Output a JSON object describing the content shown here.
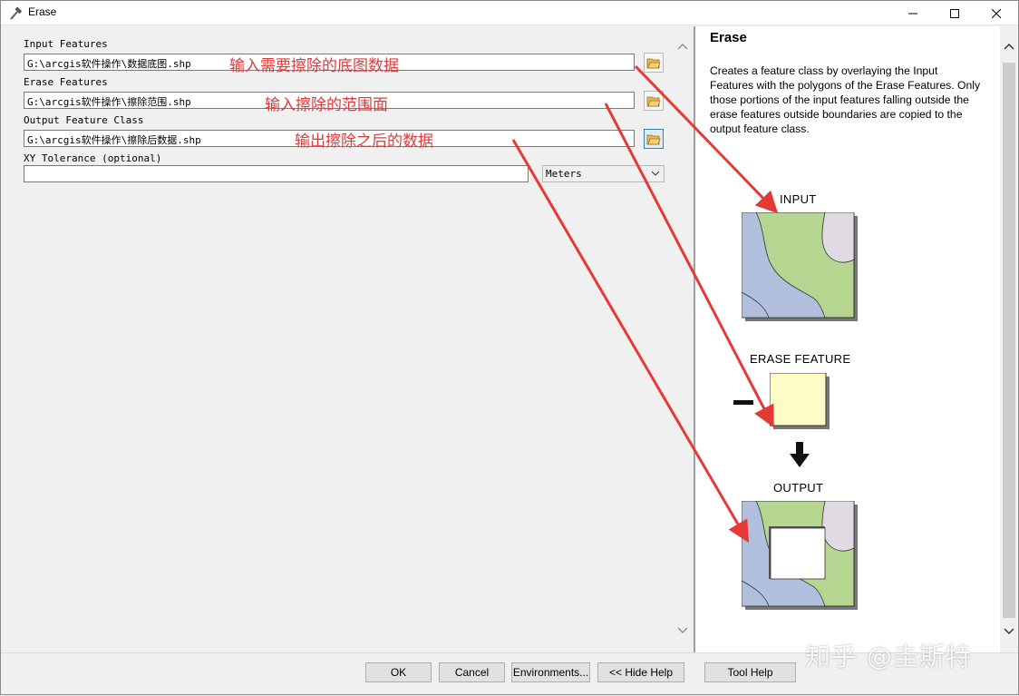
{
  "window": {
    "title": "Erase",
    "minimize_icon": "minimize-icon",
    "maximize_icon": "maximize-icon",
    "close_icon": "close-icon"
  },
  "form": {
    "input_features": {
      "label": "Input Features",
      "value": "G:\\arcgis软件操作\\数据底图.shp"
    },
    "erase_features": {
      "label": "Erase Features",
      "value": "G:\\arcgis软件操作\\擦除范围.shp"
    },
    "output_feature_class": {
      "label": "Output Feature Class",
      "value": "G:\\arcgis软件操作\\擦除后数据.shp"
    },
    "xy_tolerance": {
      "label": "XY Tolerance (optional)",
      "value": "",
      "unit": "Meters"
    }
  },
  "annotations": {
    "input": "输入需要擦除的底图数据",
    "erase": "输入擦除的范围面",
    "output": "输出擦除之后的数据",
    "color": "#e03a3a"
  },
  "help": {
    "title": "Erase",
    "description": "Creates a feature class by overlaying the Input Features with the polygons of the Erase Features. Only those portions of the input features falling outside the erase features outside boundaries are copied to the output feature class.",
    "figure": {
      "input_label": "INPUT",
      "erase_label": "ERASE FEATURE",
      "output_label": "OUTPUT",
      "minus_symbol": "minus-icon",
      "arrow_symbol": "arrow-down-icon"
    }
  },
  "buttons": {
    "ok": "OK",
    "cancel": "Cancel",
    "environments": "Environments...",
    "hide_help": "<< Hide Help",
    "tool_help": "Tool Help"
  },
  "watermark": "知乎 @圭斯特",
  "colors": {
    "green": "#b5d690",
    "blue": "#b2bfdc",
    "lavender": "#e0dbe2",
    "yellow": "#fffbc4",
    "arrow_red": "#e53935"
  }
}
